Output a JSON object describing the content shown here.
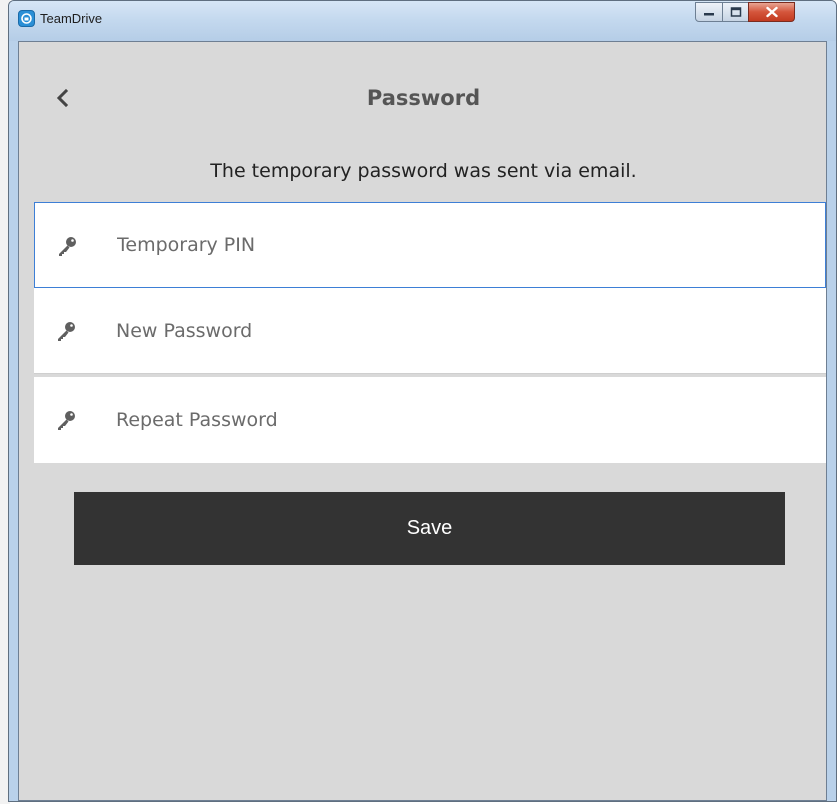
{
  "window": {
    "title": "TeamDrive",
    "app_icon": "teamdrive-logo-icon",
    "controls": [
      "minimize-icon",
      "maximize-icon",
      "close-icon"
    ]
  },
  "header": {
    "back_icon": "chevron-left-icon",
    "title": "Password"
  },
  "message": "The temporary password was sent via email.",
  "form": {
    "fields": [
      {
        "icon": "key-icon",
        "placeholder": "Temporary PIN",
        "value": "",
        "focused": true
      },
      {
        "icon": "key-icon",
        "placeholder": "New Password",
        "value": ""
      },
      {
        "icon": "key-icon",
        "placeholder": "Repeat Password",
        "value": ""
      }
    ],
    "submit_label": "Save"
  },
  "colors": {
    "background": "#d9d9d9",
    "field_background": "#ffffff",
    "focus_border": "#3d7fd6",
    "button_background": "#333333",
    "button_text": "#ffffff",
    "title_text": "#555555"
  }
}
